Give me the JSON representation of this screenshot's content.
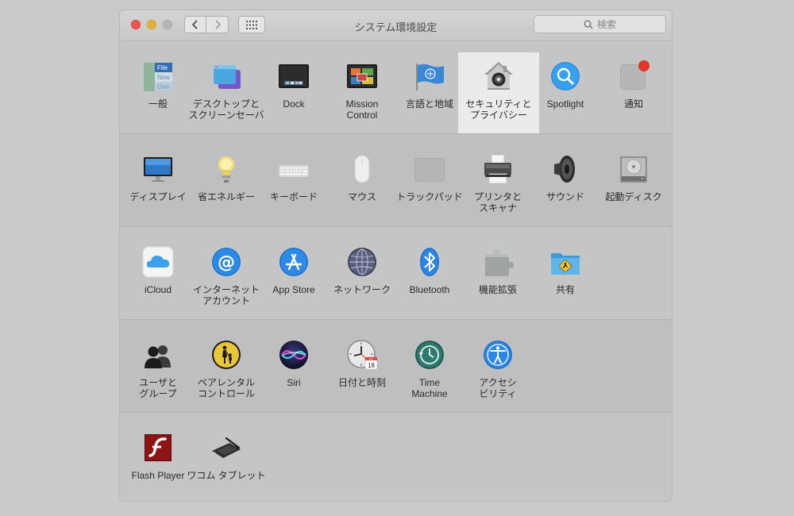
{
  "window": {
    "title": "システム環境設定",
    "search_placeholder": "検索"
  },
  "rows": [
    {
      "items": [
        {
          "id": "general",
          "label": "一般",
          "icon": "general-icon"
        },
        {
          "id": "desktop",
          "label": "デスクトップと\nスクリーンセーバ",
          "icon": "desktop-screensaver-icon"
        },
        {
          "id": "dock",
          "label": "Dock",
          "icon": "dock-icon"
        },
        {
          "id": "mission",
          "label": "Mission\nControl",
          "icon": "mission-control-icon"
        },
        {
          "id": "language",
          "label": "言語と地域",
          "icon": "flag-icon"
        },
        {
          "id": "security",
          "label": "セキュリティと\nプライバシー",
          "icon": "security-house-icon",
          "selected": true
        },
        {
          "id": "spotlight",
          "label": "Spotlight",
          "icon": "spotlight-icon"
        },
        {
          "id": "notifications",
          "label": "通知",
          "icon": "notifications-icon"
        }
      ]
    },
    {
      "items": [
        {
          "id": "displays",
          "label": "ディスプレイ",
          "icon": "display-icon"
        },
        {
          "id": "energy",
          "label": "省エネルギー",
          "icon": "lightbulb-icon"
        },
        {
          "id": "keyboard",
          "label": "キーボード",
          "icon": "keyboard-icon"
        },
        {
          "id": "mouse",
          "label": "マウス",
          "icon": "mouse-icon"
        },
        {
          "id": "trackpad",
          "label": "トラックパッド",
          "icon": "trackpad-icon"
        },
        {
          "id": "printers",
          "label": "プリンタと\nスキャナ",
          "icon": "printer-icon"
        },
        {
          "id": "sound",
          "label": "サウンド",
          "icon": "speaker-icon"
        },
        {
          "id": "startup",
          "label": "起動ディスク",
          "icon": "hard-disk-icon"
        }
      ]
    },
    {
      "items": [
        {
          "id": "icloud",
          "label": "iCloud",
          "icon": "icloud-icon"
        },
        {
          "id": "internet",
          "label": "インターネット\nアカウント",
          "icon": "at-sign-icon"
        },
        {
          "id": "appstore",
          "label": "App Store",
          "icon": "app-store-icon"
        },
        {
          "id": "network",
          "label": "ネットワーク",
          "icon": "network-globe-icon"
        },
        {
          "id": "bluetooth",
          "label": "Bluetooth",
          "icon": "bluetooth-icon"
        },
        {
          "id": "extensions",
          "label": "機能拡張",
          "icon": "puzzle-icon"
        },
        {
          "id": "sharing",
          "label": "共有",
          "icon": "sharing-folder-icon"
        }
      ]
    },
    {
      "items": [
        {
          "id": "users",
          "label": "ユーザと\nグループ",
          "icon": "users-icon"
        },
        {
          "id": "parental",
          "label": "ペアレンタル\nコントロール",
          "icon": "parental-controls-icon"
        },
        {
          "id": "siri",
          "label": "Siri",
          "icon": "siri-icon"
        },
        {
          "id": "datetime",
          "label": "日付と時刻",
          "icon": "clock-calendar-icon"
        },
        {
          "id": "timemachine",
          "label": "Time\nMachine",
          "icon": "time-machine-icon"
        },
        {
          "id": "accessibility",
          "label": "アクセシ\nビリティ",
          "icon": "accessibility-icon"
        }
      ]
    },
    {
      "items": [
        {
          "id": "flash",
          "label": "Flash Player",
          "icon": "flash-icon"
        },
        {
          "id": "wacom",
          "label": "ワコム タブレット",
          "icon": "tablet-pen-icon"
        }
      ]
    }
  ],
  "general_icon_text": [
    "File",
    "New",
    "One"
  ],
  "calendar_icon_text": {
    "month": "JUL",
    "day": "18"
  }
}
